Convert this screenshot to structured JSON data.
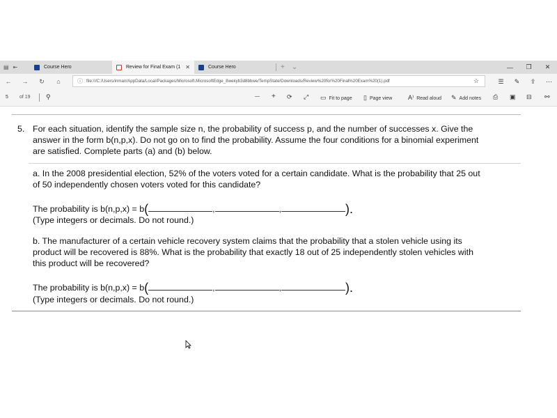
{
  "tabs": [
    {
      "title": "Course Hero",
      "active": false,
      "icon": "course-hero-icon"
    },
    {
      "title": "Review for Final Exam (1",
      "active": true,
      "icon": "pdf-icon",
      "close": "✕"
    },
    {
      "title": "Course Hero",
      "active": false,
      "icon": "course-hero-icon"
    }
  ],
  "window": {
    "minimize": "—",
    "restore": "❐",
    "close": "✕"
  },
  "address": {
    "url": "file:///C:/Users/inman/AppData/Local/Packages/Microsoft.MicrosoftEdge_8wekyb3d8bbwe/TempState/Downloads/Review%20for%20Final%20Exam%20(1).pdf"
  },
  "pdf_toolbar": {
    "page": "5",
    "of_pages": "of 19",
    "fit_to_page": "Fit to page",
    "page_view": "Page view",
    "read_aloud": "Read aloud",
    "add_notes": "Add notes"
  },
  "question": {
    "number": "5.",
    "line1": "For each situation, identify the sample size n, the probability of success p, and the number of successes x. Give the",
    "line2": "answer in the form b(n,p,x). Do not go on to find the probability. Assume the four conditions for a binomial experiment",
    "line3": "are satisfied. Complete parts (a) and (b) below.",
    "part_a": {
      "line1": "a. In the 2008 presidential election, 52% of the voters voted for a certain candidate. What is the probability that 25 out",
      "line2": "of 50 independently chosen voters voted for this candidate?",
      "prompt": "The probability is b(n,p,x) = b",
      "note": "(Type integers or decimals. Do not round.)"
    },
    "part_b": {
      "line1": "b. The manufacturer of a certain vehicle recovery system claims that the probability that a stolen vehicle using its",
      "line2": "product will be recovered is 88%. What is the probability that exactly 18 out of 25 independently stolen vehicles with",
      "line3": "this product will be recovered?",
      "prompt": "The probability is b(n,p,x) = b",
      "note": "(Type integers or decimals. Do not round.)"
    },
    "comma": ",",
    "open_paren": "(",
    "close_paren": ").",
    "period": "."
  },
  "colors": {
    "chrome": "#dcdcdc",
    "toolbar": "#f4f4f4",
    "accent_blue": "#1b3f8f",
    "pdf_red": "#c0392b"
  }
}
